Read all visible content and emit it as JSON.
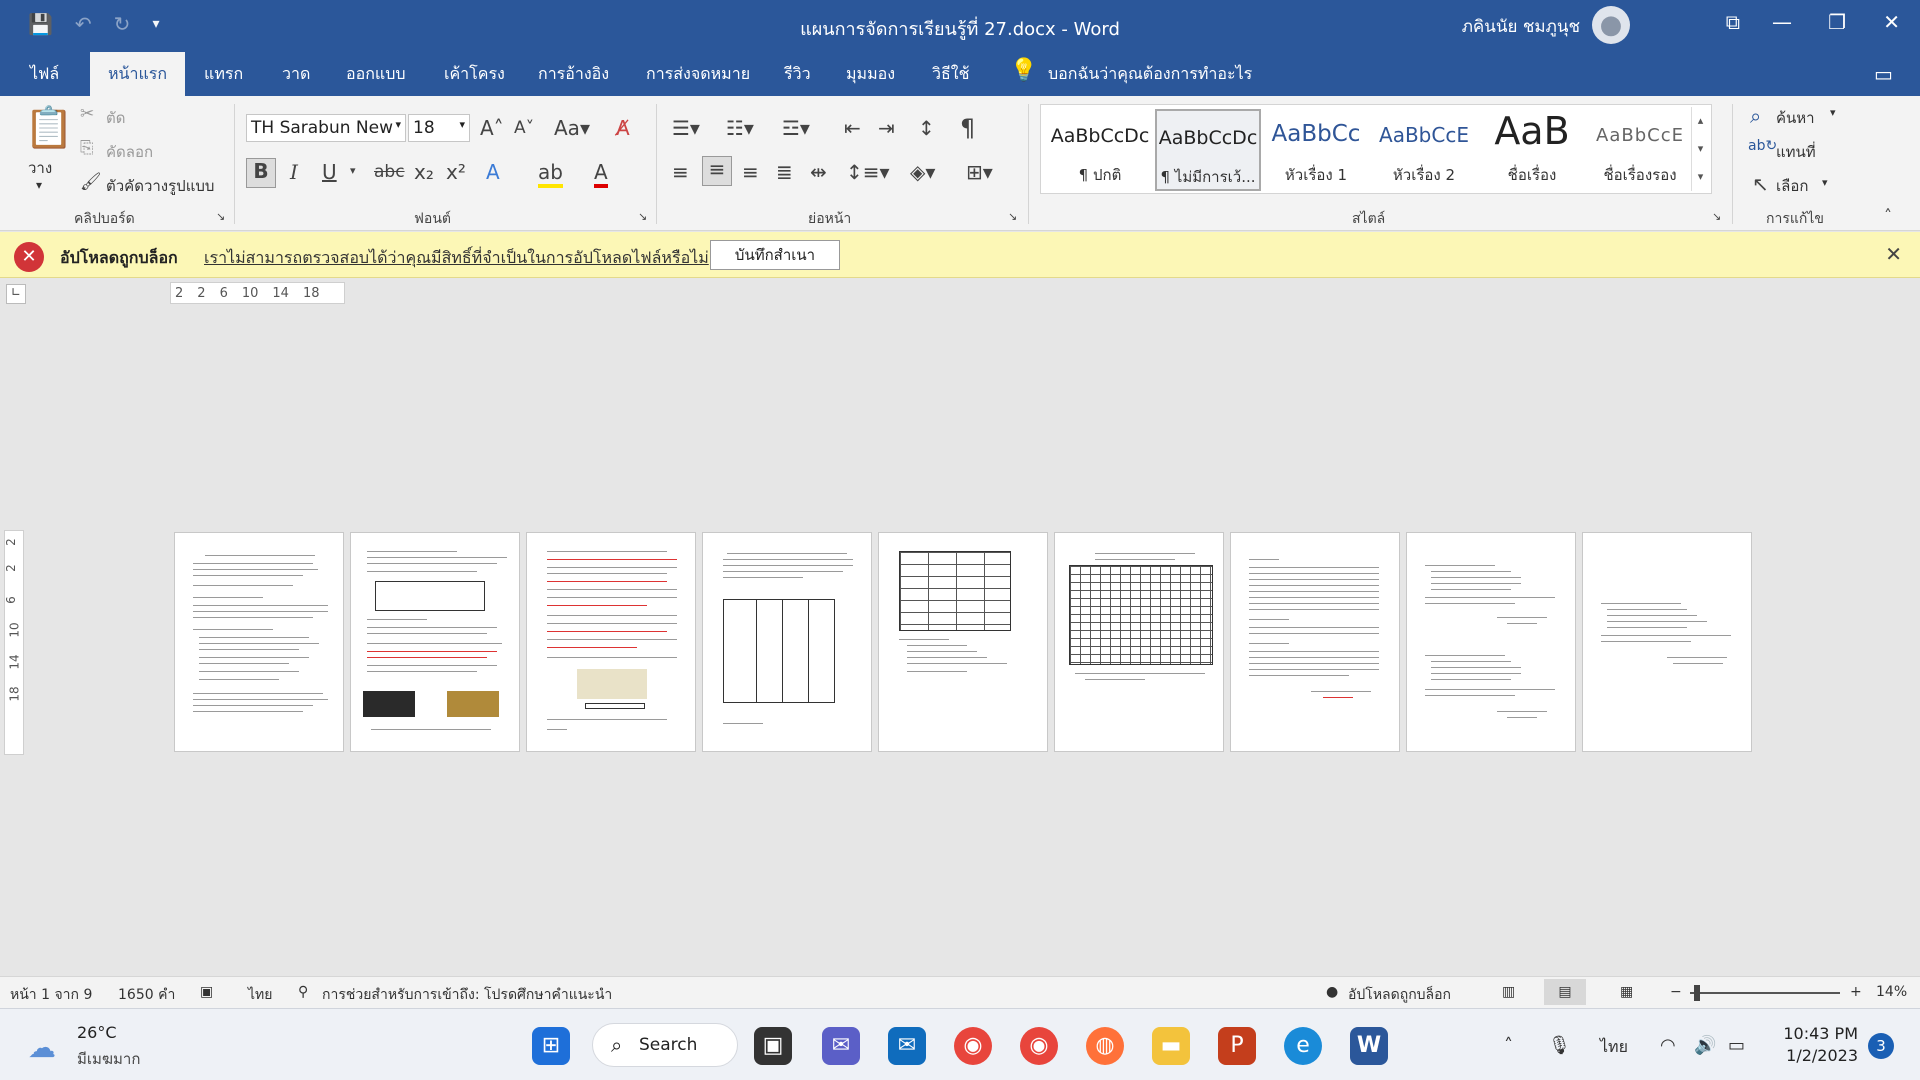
{
  "window": {
    "title": "แผนการจัดการเรียนรู้ที่ 27.docx  -  Word",
    "user": "ภคินนัย ชมภูนุช"
  },
  "tabs": [
    "ไฟล์",
    "หน้าแรก",
    "แทรก",
    "วาด",
    "ออกแบบ",
    "เค้าโครง",
    "การอ้างอิง",
    "การส่งจดหมาย",
    "รีวิว",
    "มุมมอง",
    "วิธีใช้"
  ],
  "tell_me": "บอกฉันว่าคุณต้องการทำอะไร",
  "clipboard": {
    "paste": "วาง",
    "cut": "ตัด",
    "copy": "คัดลอก",
    "format_painter": "ตัวคัดวางรูปแบบ",
    "group_label": "คลิปบอร์ด"
  },
  "font": {
    "name": "TH Sarabun New",
    "size": "18",
    "group_label": "ฟอนต์"
  },
  "paragraph": {
    "group_label": "ย่อหน้า"
  },
  "styles": {
    "group_label": "สไตล์",
    "items": [
      {
        "sample": "AaBbCcDc",
        "name": "¶ ปกติ"
      },
      {
        "sample": "AaBbCcDc",
        "name": "¶ ไม่มีการเว้..."
      },
      {
        "sample": "AaBbCc",
        "name": "หัวเรื่อง 1"
      },
      {
        "sample": "AaBbCcE",
        "name": "หัวเรื่อง 2"
      },
      {
        "sample": "AaB",
        "name": "ชื่อเรื่อง"
      },
      {
        "sample": "AaBbCcE",
        "name": "ชื่อเรื่องรอง"
      }
    ]
  },
  "editing": {
    "find": "ค้นหา",
    "replace": "แทนที่",
    "select": "เลือก",
    "group_label": "การแก้ไข"
  },
  "message_bar": {
    "title": "อัปโหลดถูกบล็อก",
    "text": "เราไม่สามารถตรวจสอบได้ว่าคุณมีสิทธิ์ที่จำเป็นในการอัปโหลดไฟล์หรือไม่",
    "button": "บันทึกสำเนา"
  },
  "ruler": {
    "ticks": [
      "2",
      "2",
      "6",
      "10",
      "14",
      "18"
    ],
    "vticks": [
      "2",
      "2",
      "6",
      "10",
      "14",
      "18"
    ]
  },
  "status": {
    "page": "หน้า 1 จาก 9",
    "words": "1650 คำ",
    "language": "ไทย",
    "accessibility": "การช่วยสำหรับการเข้าถึง: โปรดศึกษาคำแนะนำ",
    "upload": "อัปโหลดถูกบล็อก",
    "zoom": "14%"
  },
  "taskbar": {
    "temp": "26°C",
    "weather": "มีเมฆมาก",
    "search": "Search",
    "lang": "ไทย",
    "time": "10:43 PM",
    "date": "1/2/2023",
    "notifications": "3"
  },
  "colors": {
    "accent": "#2b579a",
    "message_bg": "#fcf7b6",
    "error": "#d13438"
  }
}
